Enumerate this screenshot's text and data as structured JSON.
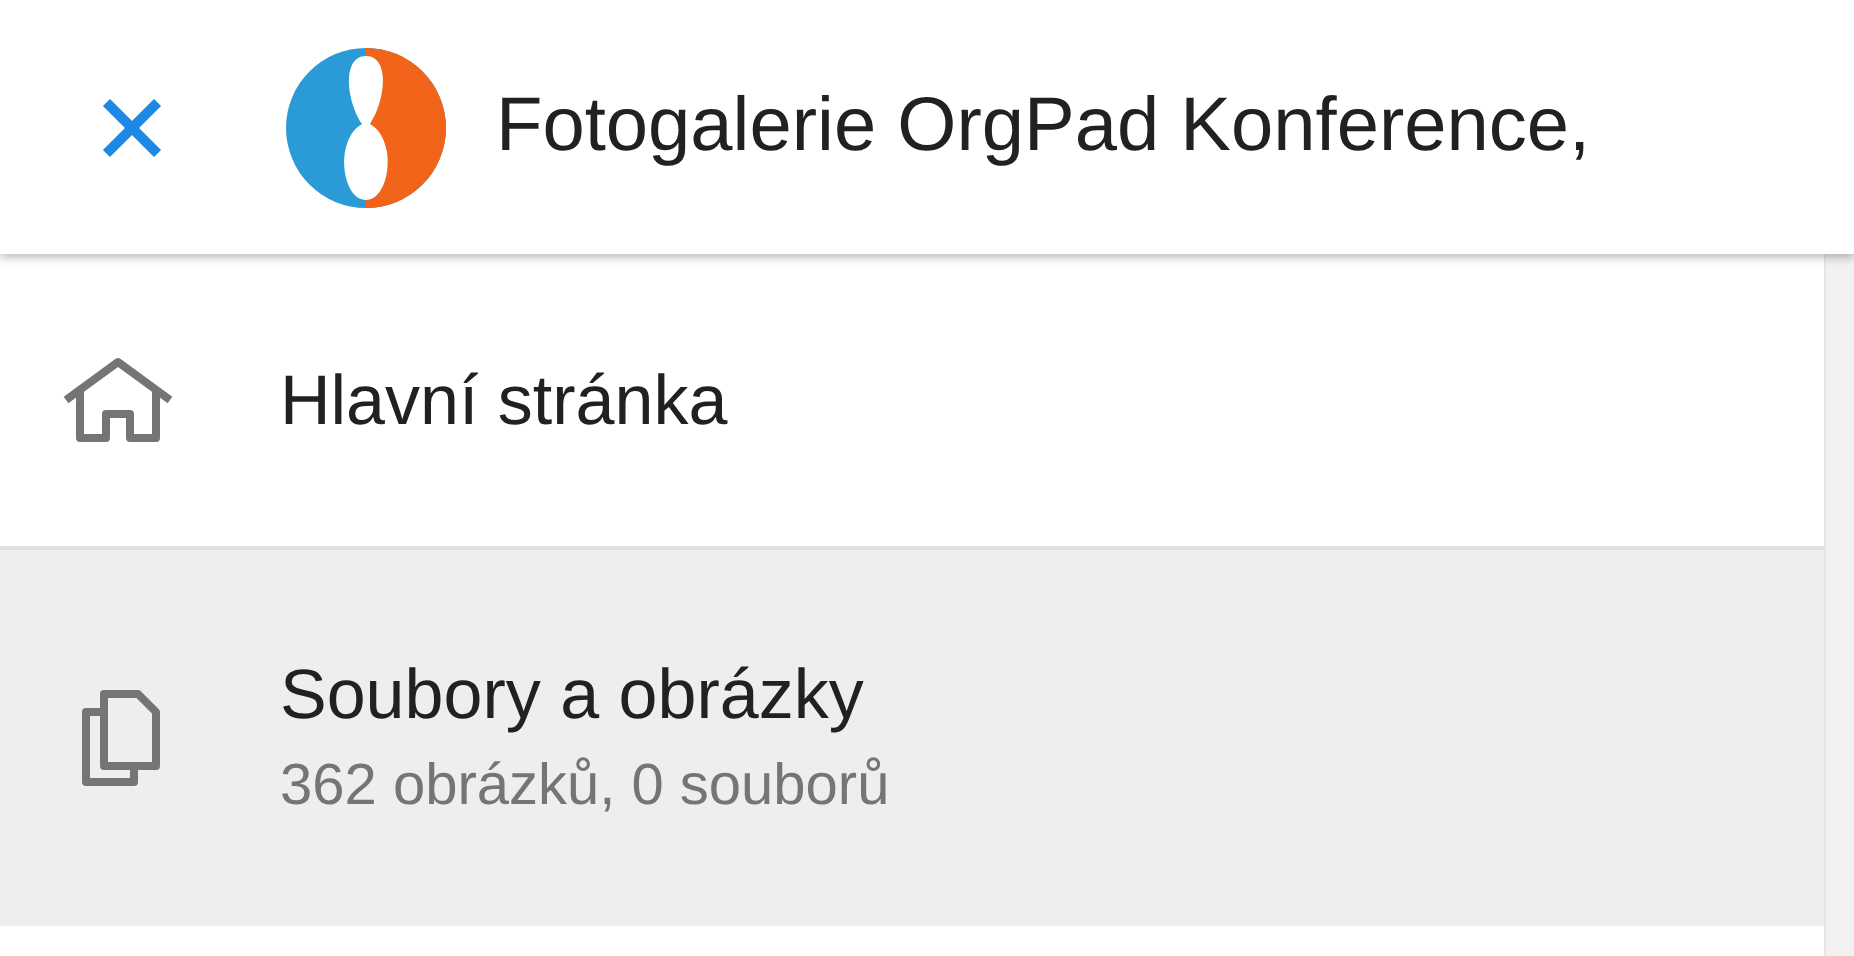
{
  "header": {
    "title": "Fotogalerie OrgPad Konference,"
  },
  "menu": [
    {
      "label": "Hlavní stránka",
      "selected": false
    },
    {
      "label": "Soubory a obrázky",
      "subtitle": "362 obrázků, 0 souborů",
      "selected": true
    }
  ]
}
